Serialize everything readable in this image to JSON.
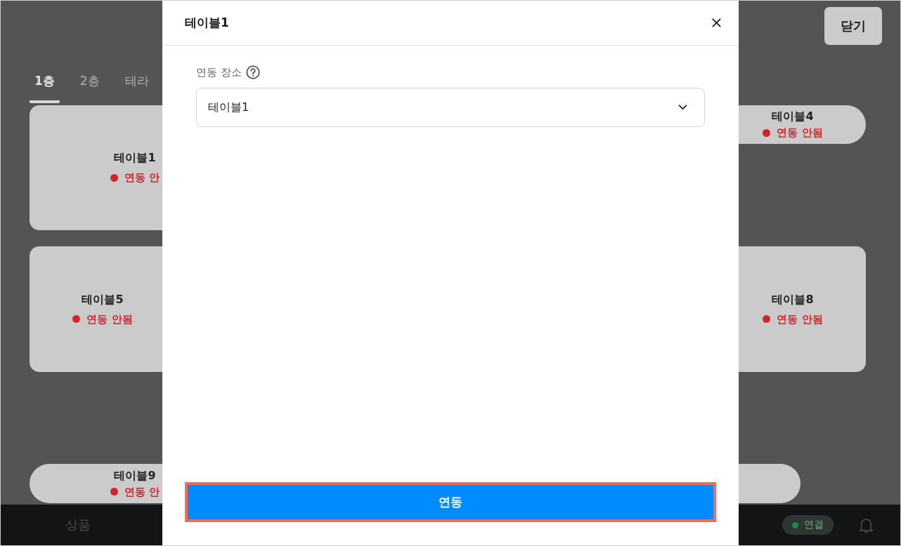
{
  "app": {
    "close_button": "닫기",
    "tabs": [
      {
        "label": "1층",
        "selected": true
      },
      {
        "label": "2층",
        "selected": false
      },
      {
        "label": "테라",
        "selected": false
      }
    ],
    "tables": [
      {
        "kind": "square",
        "name": "테이블1",
        "status": "연동 안",
        "linked": false
      },
      {
        "kind": "round",
        "name": "테이블4",
        "status": "연동 안됨",
        "linked": false
      },
      {
        "kind": "square",
        "name": "테이블5",
        "status": "연동 안됨",
        "linked": false
      },
      {
        "kind": "square",
        "name": "테이블8",
        "status": "연동 안됨",
        "linked": false
      },
      {
        "kind": "round",
        "name": "테이블9",
        "status": "연동 안",
        "linked": false
      },
      {
        "kind": "round"
      }
    ],
    "bottom_bar": {
      "nav_label": "상품",
      "connection": {
        "label": "연결",
        "connected": true
      }
    }
  },
  "dialog": {
    "title": "테이블1",
    "field": {
      "label": "연동 장소",
      "value": "테이블1"
    },
    "submit": {
      "label": "연동",
      "highlighted": true
    }
  }
}
